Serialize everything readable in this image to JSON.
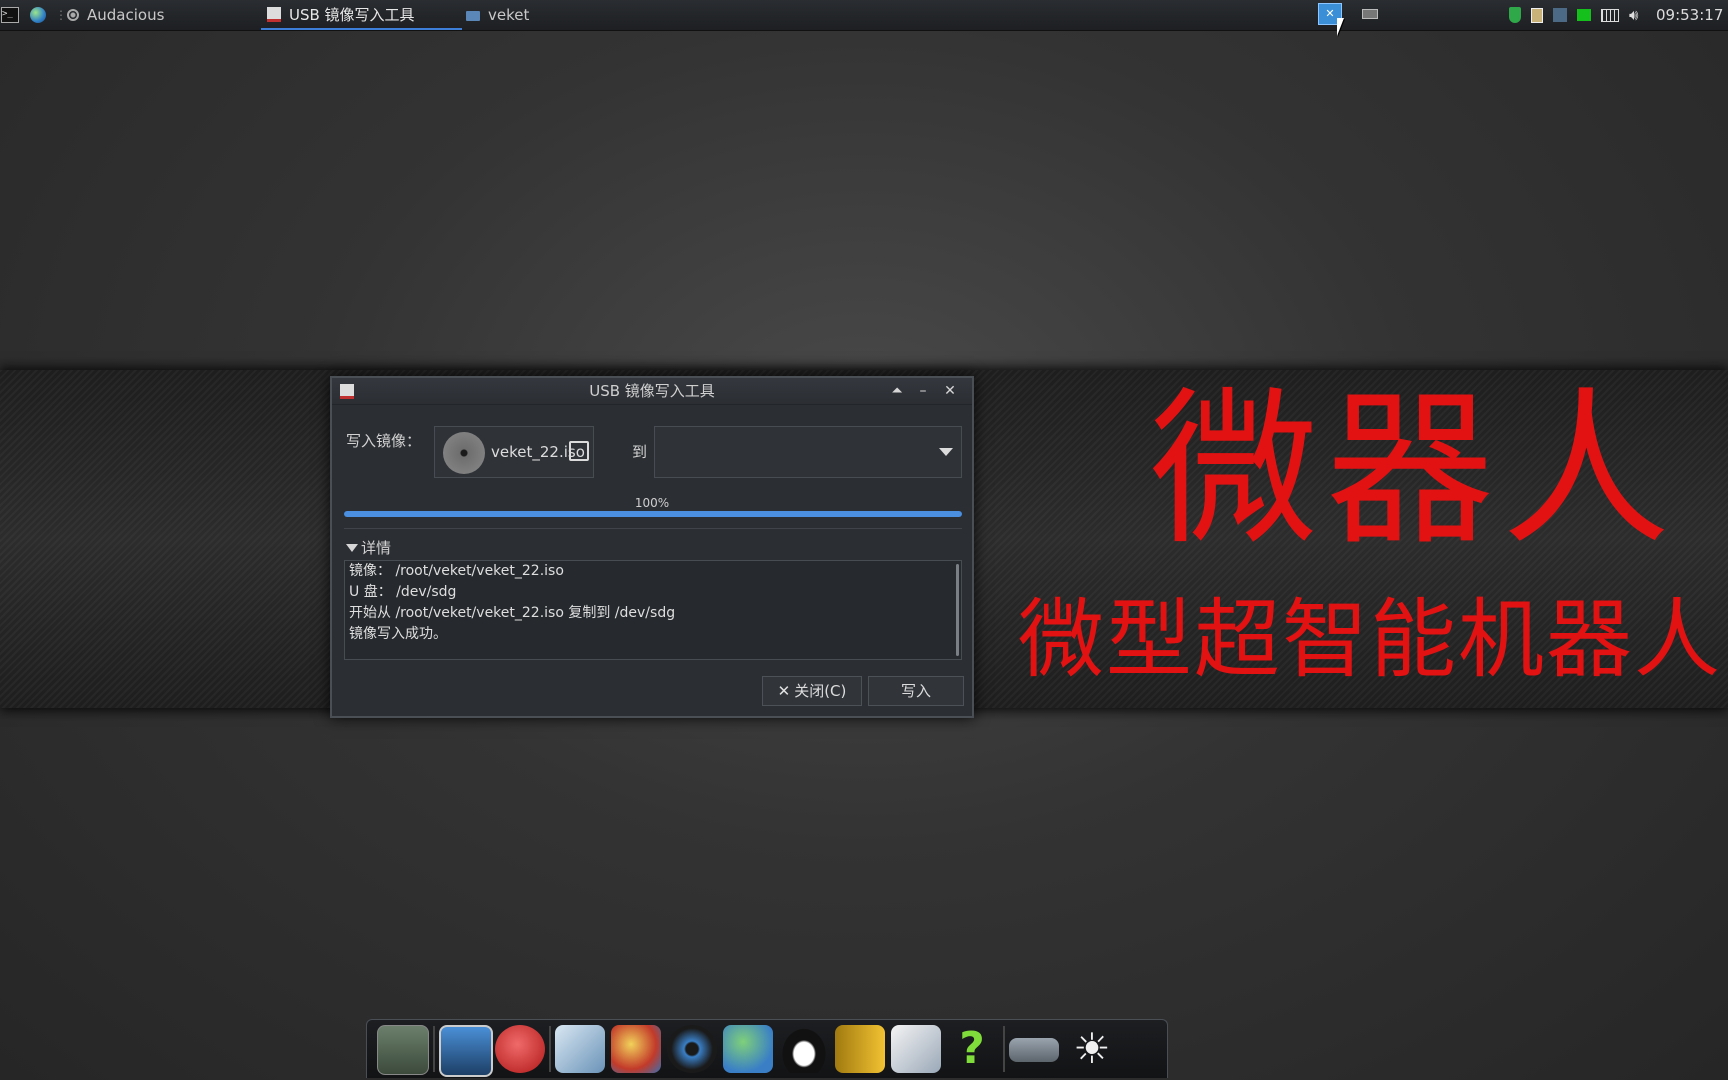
{
  "top_panel": {
    "launchers": [
      {
        "icon": "terminal-icon"
      },
      {
        "icon": "browser-globe-icon"
      }
    ],
    "tasks": [
      {
        "label": "Audacious",
        "icon": "audacious-icon",
        "active": false
      },
      {
        "label": "USB 镜像写入工具",
        "icon": "usb-writer-app-icon",
        "active": true
      },
      {
        "label": "veket",
        "icon": "folder-icon",
        "active": false
      }
    ],
    "tray_icons": [
      "shield-icon",
      "clipboard-icon",
      "network-icon",
      "battery-icon",
      "keyboard-icon",
      "volume-icon"
    ],
    "clock": "09:53:17"
  },
  "dialog": {
    "title": "USB 镜像写入工具",
    "write_image_label": "写入镜像：",
    "image_file": "veket_22.iso",
    "to_label": "到",
    "target_device": "",
    "progress_text": "100%",
    "progress_value": 1.0,
    "details_label": "详情",
    "log_lines": [
      "镜像： /root/veket/veket_22.iso",
      "U 盘： /dev/sdg",
      "开始从 /root/veket/veket_22.iso 复制到 /dev/sdg",
      "镜像写入成功。"
    ],
    "close_button": "关闭(C)",
    "write_button": "写入"
  },
  "wallpaper": {
    "title": "微器人",
    "subtitle": "微型超智能机器人",
    "text_color": "#e31212"
  },
  "dock": {
    "items": [
      "desktop-icon",
      "computer-icon",
      "pet-icon",
      "editor-icon",
      "paint-icon",
      "media-player-icon",
      "users-icon",
      "qq-penguin-icon",
      "notes-icon",
      "office-icon",
      "help-icon",
      "drive-icon",
      "brightness-icon"
    ]
  },
  "colors": {
    "accent": "#4a8fe0",
    "panel_bg": "#1d1f22",
    "dialog_bg": "#2b2e33"
  }
}
